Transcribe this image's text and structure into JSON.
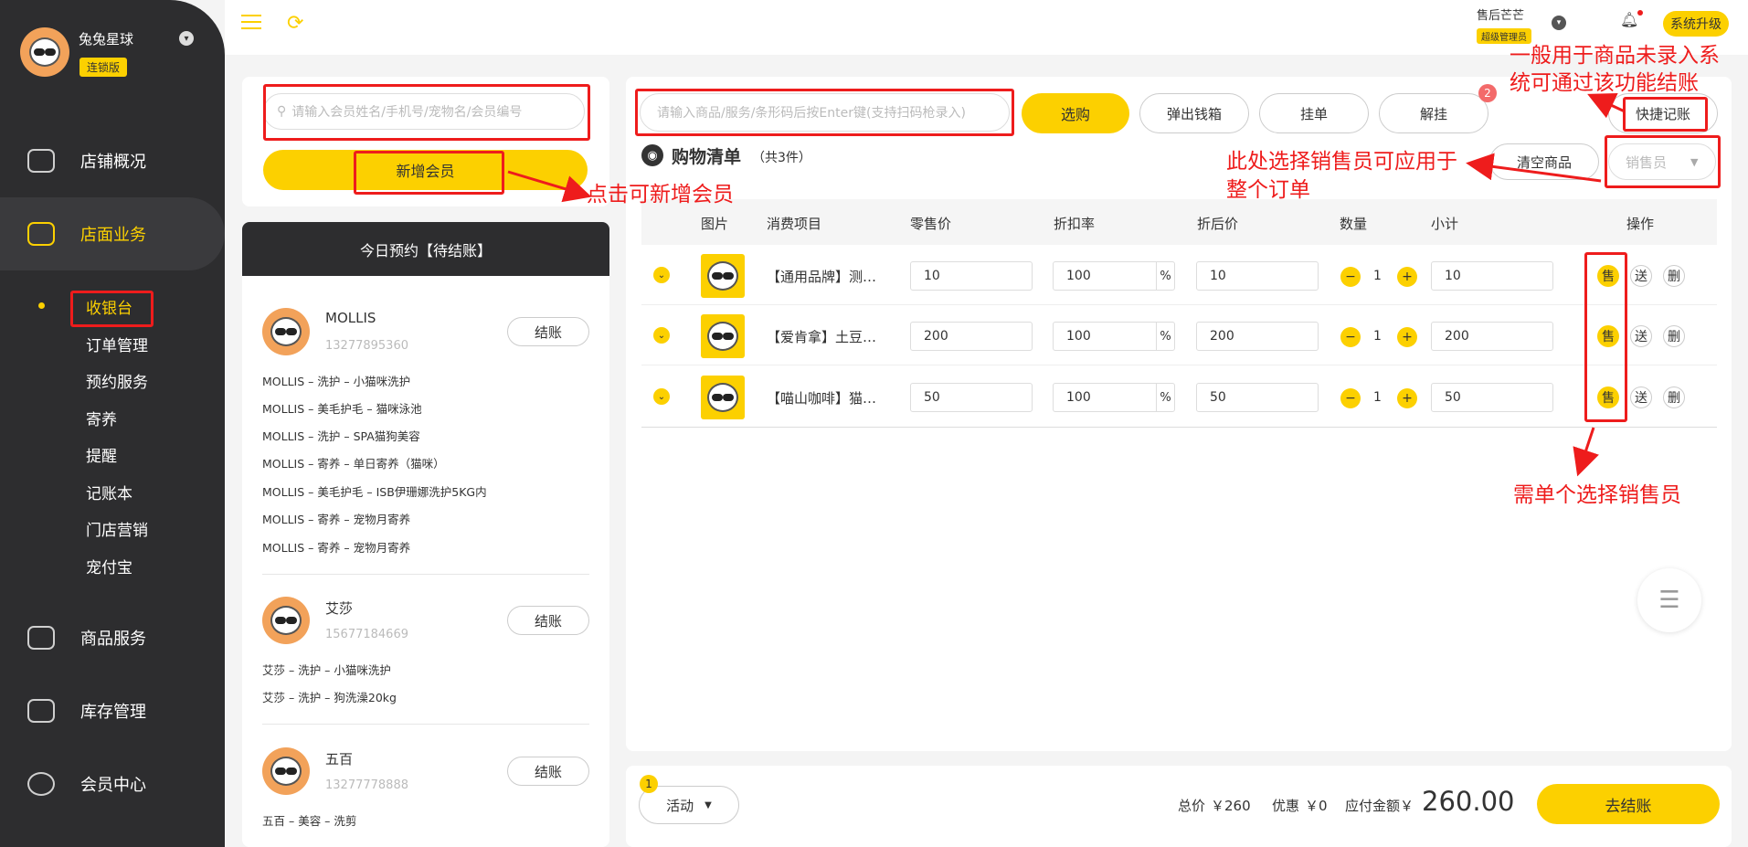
{
  "shop": {
    "name": "兔兔星球",
    "badge": "连锁版"
  },
  "nav": [
    {
      "label": "店铺概况"
    },
    {
      "label": "店面业务"
    },
    {
      "label": "商品服务"
    },
    {
      "label": "库存管理"
    },
    {
      "label": "会员中心"
    }
  ],
  "subnav": [
    "收银台",
    "订单管理",
    "预约服务",
    "寄养",
    "提醒",
    "记账本",
    "门店营销",
    "宠付宝"
  ],
  "header": {
    "user_name": "售后芒芒",
    "user_role": "超级管理员",
    "upgrade": "系统升级"
  },
  "member": {
    "search_placeholder": "请输入会员姓名/手机号/宠物名/会员编号",
    "add_button": "新增会员"
  },
  "appointments": {
    "title": "今日预约【待结账】",
    "checkout_label": "结账",
    "items": [
      {
        "name": "MOLLIS",
        "phone": "13277895360",
        "services": [
          "MOLLIS – 洗护 – 小猫咪洗护",
          "MOLLIS – 美毛护毛 – 猫咪泳池",
          "MOLLIS – 洗护 – SPA猫狗美容",
          "MOLLIS – 寄养 – 单日寄养（猫咪）",
          "MOLLIS – 美毛护毛 – ISB伊珊娜洗护5KG内",
          "MOLLIS – 寄养 – 宠物月寄养",
          "MOLLIS – 寄养 – 宠物月寄养"
        ]
      },
      {
        "name": "艾莎",
        "phone": "15677184669",
        "services": [
          "艾莎 – 洗护 – 小猫咪洗护",
          "艾莎 – 洗护 – 狗洗澡20kg"
        ]
      },
      {
        "name": "五百",
        "phone": "13277778888",
        "services": [
          "五百 – 美容 – 洗剪"
        ]
      }
    ]
  },
  "toolbar": {
    "product_placeholder": "请输入商品/服务/条形码后按Enter键(支持扫码枪录入)",
    "select": "选购",
    "cash_drawer": "弹出钱箱",
    "hang": "挂单",
    "unhang": "解挂",
    "unhang_badge": "2",
    "quick": "快捷记账"
  },
  "cart": {
    "title": "购物清单",
    "count": "（共3件）",
    "clear": "清空商品",
    "seller_placeholder": "销售员",
    "columns": [
      "图片",
      "消费项目",
      "零售价",
      "折扣率",
      "折后价",
      "数量",
      "小计",
      "操作"
    ],
    "percent": "%",
    "actions": {
      "sell": "售",
      "gift": "送",
      "delete": "删"
    },
    "rows": [
      {
        "name": "【通用品牌】测…",
        "price": "10",
        "discount": "100",
        "after": "10",
        "qty": "1",
        "subtotal": "10"
      },
      {
        "name": "【爱肯拿】土豆…",
        "price": "200",
        "discount": "100",
        "after": "200",
        "qty": "1",
        "subtotal": "200"
      },
      {
        "name": "【喵山咖啡】猫…",
        "price": "50",
        "discount": "100",
        "after": "50",
        "qty": "1",
        "subtotal": "50"
      }
    ]
  },
  "footer": {
    "activity": "活动",
    "activity_badge": "1",
    "total_label": "总价",
    "total": "￥260",
    "discount_label": "优惠",
    "discount": "￥0",
    "payable_label": "应付金额￥",
    "payable": "260.00",
    "checkout": "去结账"
  },
  "annotations": {
    "add_member": "点击可新增会员",
    "quick_line1": "一般用于商品未录入系",
    "quick_line2": "统可通过该功能结账",
    "seller_line1": "此处选择销售员可应用于",
    "seller_line2": "整个订单",
    "per_item": "需单个选择销售员"
  },
  "colors": {
    "accent": "#fcd000",
    "sidebar": "#2d2d2f",
    "annotation": "#ee1c1c"
  }
}
